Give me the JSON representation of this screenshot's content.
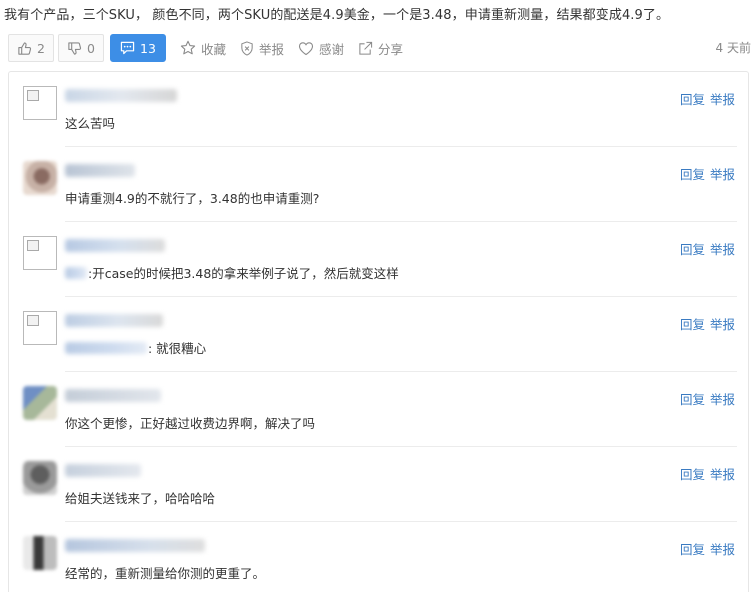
{
  "post": {
    "text": "我有个产品，三个SKU， 颜色不同，两个SKU的配送是4.9美金，一个是3.48，申请重新测量，结果都变成4.9了。"
  },
  "actions": {
    "like_count": "2",
    "dislike_count": "0",
    "comment_count": "13",
    "favorite_label": "收藏",
    "report_label": "举报",
    "thanks_label": "感谢",
    "share_label": "分享",
    "timestamp": "4 天前",
    "comments_button_color": "#3d8ee6"
  },
  "comment_actions": {
    "reply_label": "回复",
    "report_label": "举报",
    "link_color": "#3a7bc2"
  },
  "comments": [
    {
      "text": "这么苦吗",
      "avatar": "broken-image-icon"
    },
    {
      "text": "申请重测4.9的不就行了，3.48的也申请重测?",
      "avatar": "blurred-avatar"
    },
    {
      "text": ":开case的时候把3.48的拿来举例子说了，然后就变这样",
      "avatar": "broken-image-icon"
    },
    {
      "text": ": 就很糟心",
      "avatar": "broken-image-icon"
    },
    {
      "text": "你这个更惨，正好越过收费边界啊，解决了吗",
      "avatar": "blurred-avatar"
    },
    {
      "text": "给姐夫送钱来了，哈哈哈哈",
      "avatar": "blurred-avatar"
    },
    {
      "text": "经常的，重新测量给你测的更重了。",
      "avatar": "blurred-avatar"
    }
  ]
}
